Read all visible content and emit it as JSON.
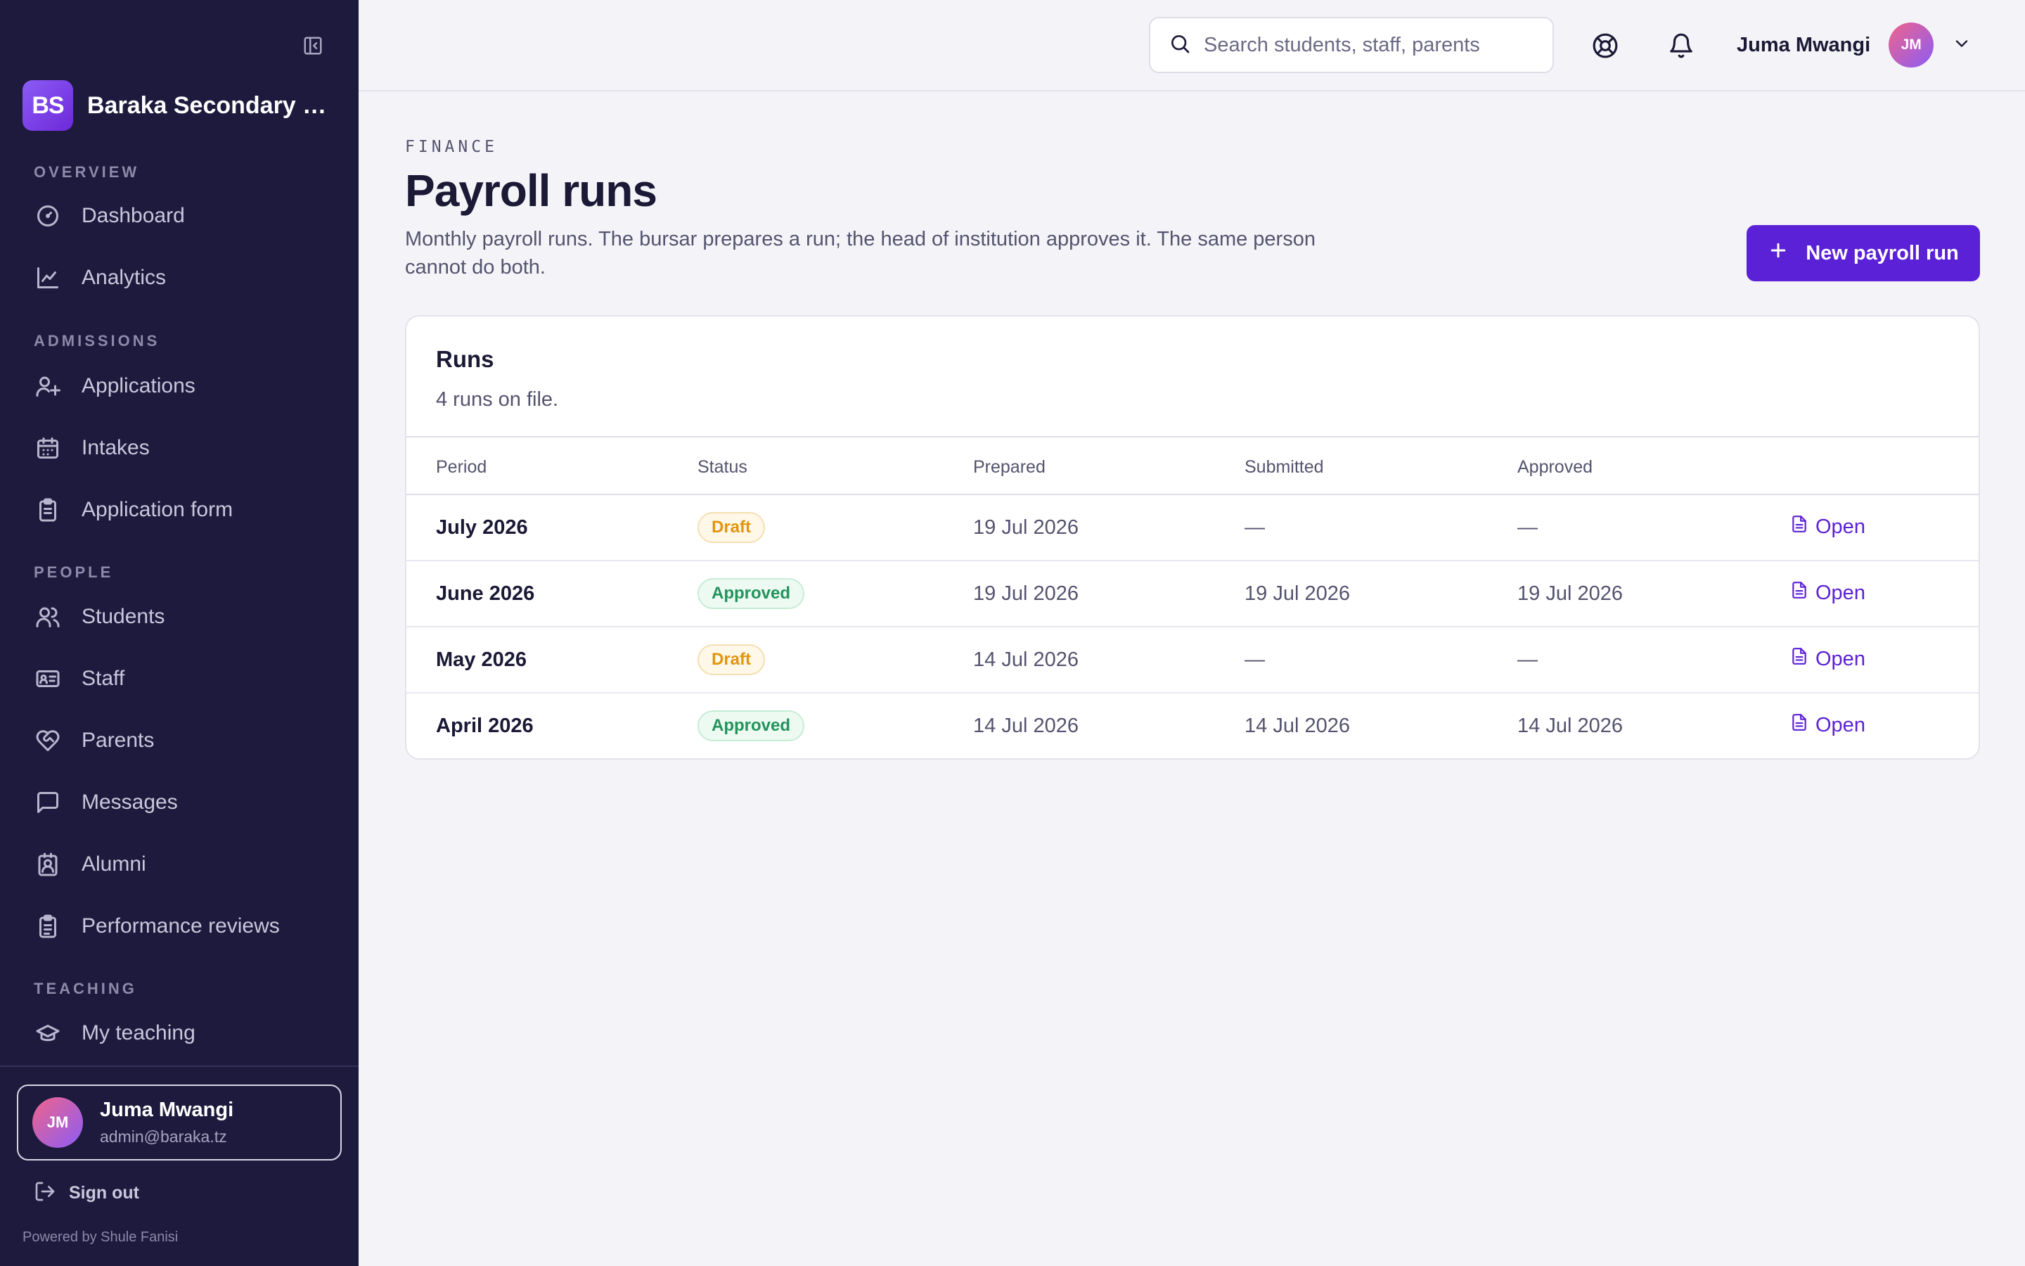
{
  "sidebar": {
    "brand": {
      "initials": "BS",
      "name": "Baraka Secondary School"
    },
    "sections": [
      {
        "label": "OVERVIEW",
        "items": [
          {
            "label": "Dashboard",
            "icon": "gauge-icon"
          },
          {
            "label": "Analytics",
            "icon": "line-chart-icon"
          }
        ]
      },
      {
        "label": "ADMISSIONS",
        "items": [
          {
            "label": "Applications",
            "icon": "user-plus-icon"
          },
          {
            "label": "Intakes",
            "icon": "calendar-icon"
          },
          {
            "label": "Application form",
            "icon": "clipboard-icon"
          }
        ]
      },
      {
        "label": "PEOPLE",
        "items": [
          {
            "label": "Students",
            "icon": "users-icon"
          },
          {
            "label": "Staff",
            "icon": "id-card-icon"
          },
          {
            "label": "Parents",
            "icon": "heart-handshake-icon"
          },
          {
            "label": "Messages",
            "icon": "message-square-icon"
          },
          {
            "label": "Alumni",
            "icon": "contact-icon"
          },
          {
            "label": "Performance reviews",
            "icon": "clipboard-list-icon"
          }
        ]
      },
      {
        "label": "TEACHING",
        "items": [
          {
            "label": "My teaching",
            "icon": "graduation-cap-icon"
          }
        ]
      }
    ],
    "user": {
      "initials": "JM",
      "name": "Juma Mwangi",
      "email": "admin@baraka.tz"
    },
    "signout_label": "Sign out",
    "powered_by": "Powered by Shule Fanisi"
  },
  "topbar": {
    "search_placeholder": "Search students, staff, parents",
    "user_name": "Juma Mwangi",
    "user_initials": "JM"
  },
  "page": {
    "eyebrow": "FINANCE",
    "title": "Payroll runs",
    "description": "Monthly payroll runs. The bursar prepares a run; the head of institution approves it. The same person cannot do both.",
    "new_button": "New payroll run"
  },
  "runs_card": {
    "title": "Runs",
    "subtitle": "4 runs on file.",
    "columns": [
      "Period",
      "Status",
      "Prepared",
      "Submitted",
      "Approved"
    ],
    "rows": [
      {
        "period": "July 2026",
        "status": "Draft",
        "prepared": "19 Jul 2026",
        "submitted": "—",
        "approved": "—",
        "action": "Open"
      },
      {
        "period": "June 2026",
        "status": "Approved",
        "prepared": "19 Jul 2026",
        "submitted": "19 Jul 2026",
        "approved": "19 Jul 2026",
        "action": "Open"
      },
      {
        "period": "May 2026",
        "status": "Draft",
        "prepared": "14 Jul 2026",
        "submitted": "—",
        "approved": "—",
        "action": "Open"
      },
      {
        "period": "April 2026",
        "status": "Approved",
        "prepared": "14 Jul 2026",
        "submitted": "14 Jul 2026",
        "approved": "14 Jul 2026",
        "action": "Open"
      }
    ]
  },
  "colors": {
    "sidebar_bg": "#1e1a3d",
    "accent": "#5b21d6",
    "draft": "#e1950f",
    "approved": "#23935c",
    "page_bg": "#f4f4f8"
  }
}
